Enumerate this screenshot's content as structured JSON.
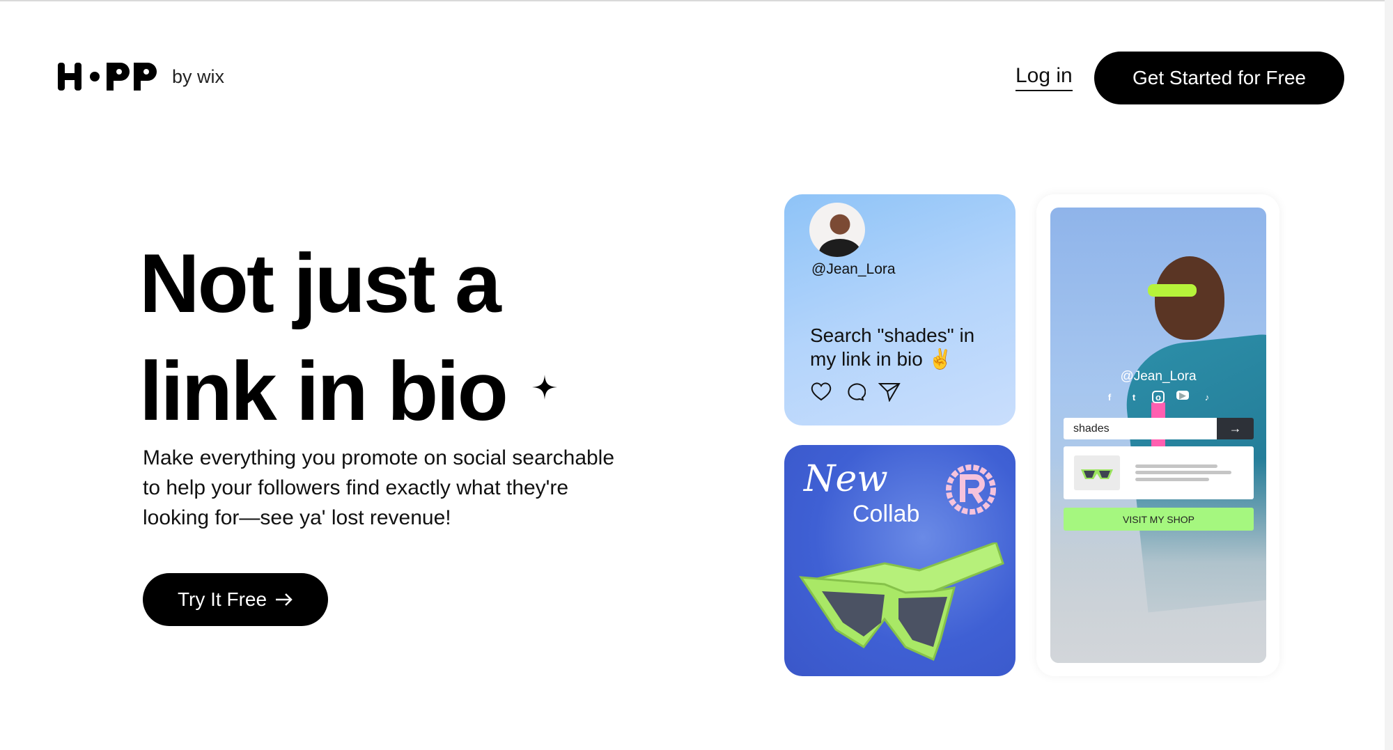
{
  "header": {
    "logo_text": "H•PP",
    "logo_suffix": "by wix",
    "login_label": "Log in",
    "cta_label": "Get Started for Free"
  },
  "hero": {
    "headline_line1": "Not just a",
    "headline_line2": "link in bio",
    "description": "Make everything you promote on social searchable to help your followers find exactly what they're looking for—see ya' lost revenue!",
    "try_label": "Try It Free",
    "try_icon": "arrow-right-icon"
  },
  "post_card": {
    "handle": "@Jean_Lora",
    "text": "Search \"shades\" in my link in bio ✌️",
    "icons": [
      "heart-icon",
      "comment-icon",
      "send-icon"
    ]
  },
  "collab_card": {
    "title_line1": "New",
    "title_line2": "Collab"
  },
  "phone": {
    "handle": "@Jean_Lora",
    "social_icons": [
      "facebook-icon",
      "twitter-icon",
      "instagram-icon",
      "youtube-icon",
      "tiktok-icon"
    ],
    "search_value": "shades",
    "visit_label": "VISIT MY SHOP",
    "accent": "#a5f77f"
  }
}
